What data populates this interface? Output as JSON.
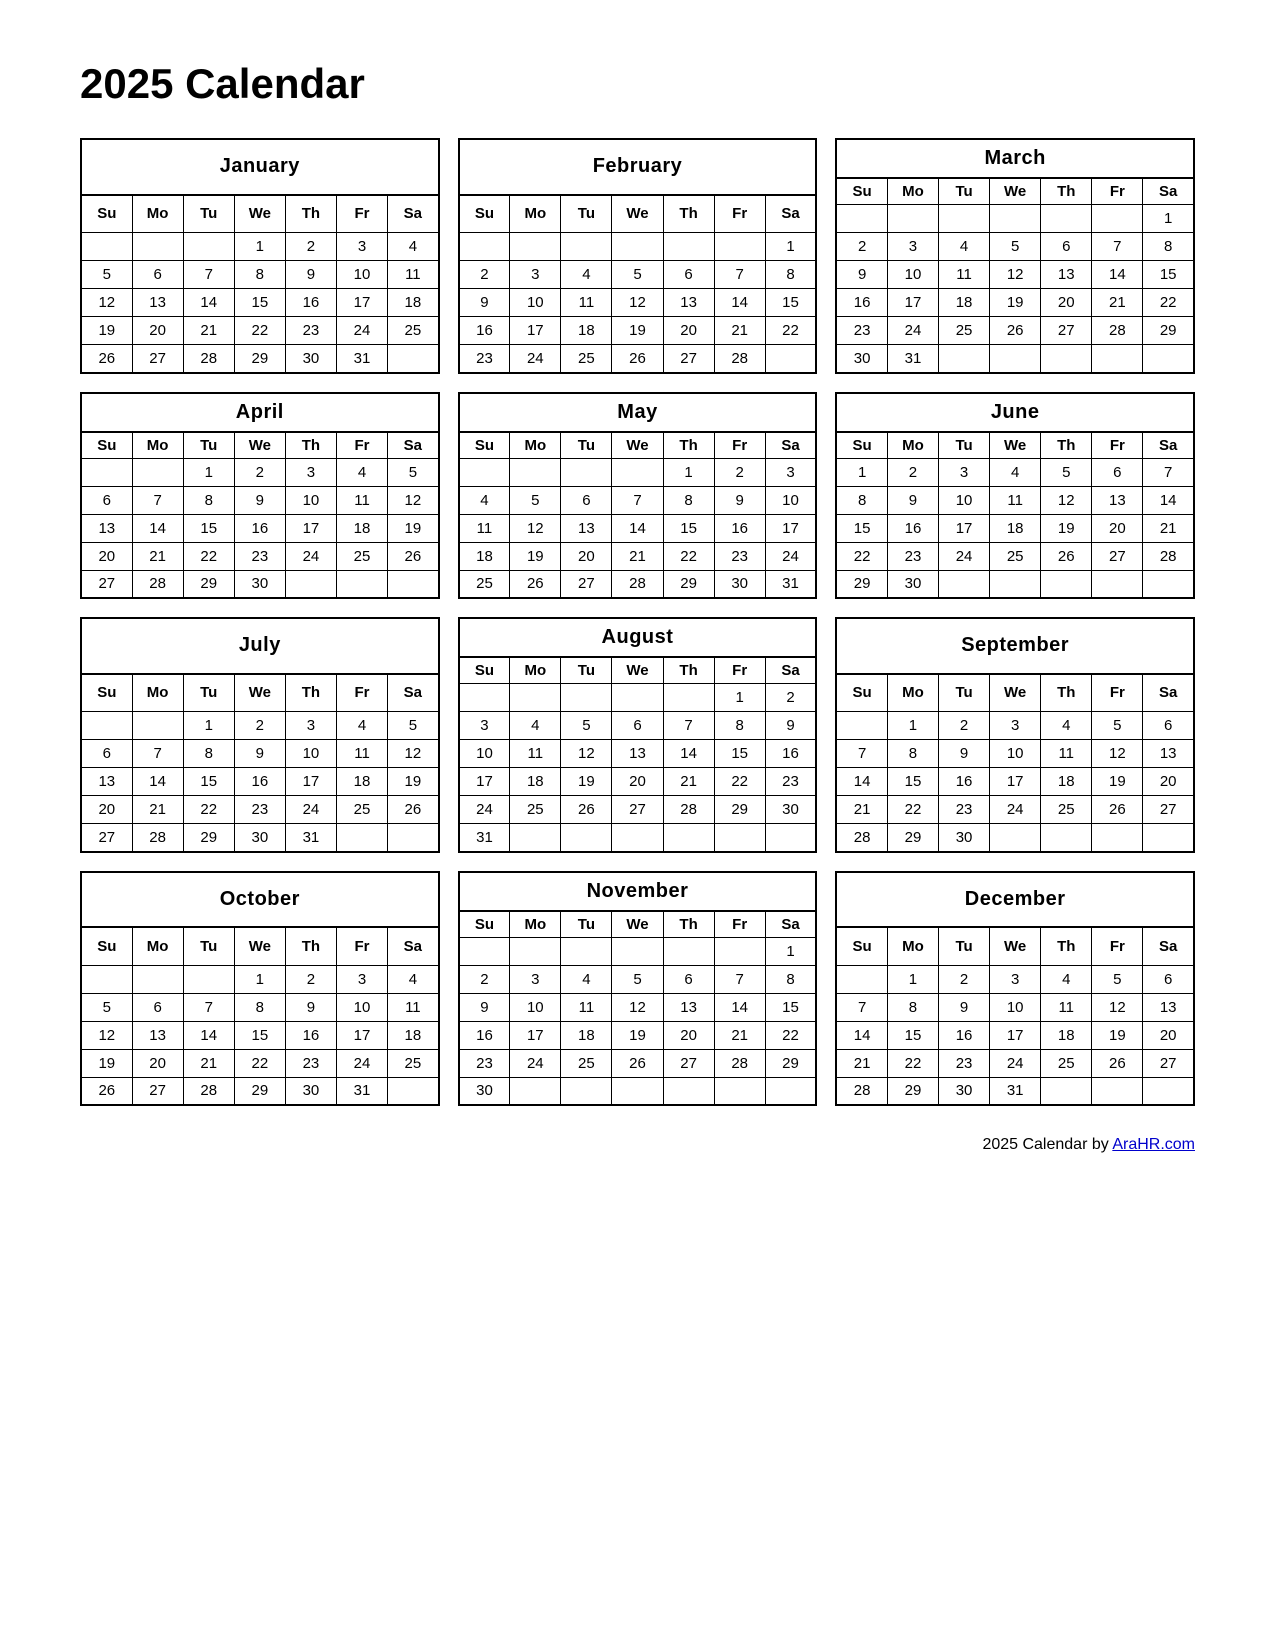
{
  "title": "2025 Calendar",
  "footer": {
    "text": "2025  Calendar by ",
    "link_text": "AraHR.com",
    "link_url": "#"
  },
  "months": [
    {
      "name": "January",
      "days_header": [
        "Su",
        "Mo",
        "Tu",
        "We",
        "Th",
        "Fr",
        "Sa"
      ],
      "weeks": [
        [
          "",
          "",
          "",
          "1",
          "2",
          "3",
          "4"
        ],
        [
          "5",
          "6",
          "7",
          "8",
          "9",
          "10",
          "11"
        ],
        [
          "12",
          "13",
          "14",
          "15",
          "16",
          "17",
          "18"
        ],
        [
          "19",
          "20",
          "21",
          "22",
          "23",
          "24",
          "25"
        ],
        [
          "26",
          "27",
          "28",
          "29",
          "30",
          "31",
          ""
        ]
      ]
    },
    {
      "name": "February",
      "days_header": [
        "Su",
        "Mo",
        "Tu",
        "We",
        "Th",
        "Fr",
        "Sa"
      ],
      "weeks": [
        [
          "",
          "",
          "",
          "",
          "",
          "",
          "1"
        ],
        [
          "2",
          "3",
          "4",
          "5",
          "6",
          "7",
          "8"
        ],
        [
          "9",
          "10",
          "11",
          "12",
          "13",
          "14",
          "15"
        ],
        [
          "16",
          "17",
          "18",
          "19",
          "20",
          "21",
          "22"
        ],
        [
          "23",
          "24",
          "25",
          "26",
          "27",
          "28",
          ""
        ]
      ]
    },
    {
      "name": "March",
      "days_header": [
        "Su",
        "Mo",
        "Tu",
        "We",
        "Th",
        "Fr",
        "Sa"
      ],
      "weeks": [
        [
          "",
          "",
          "",
          "",
          "",
          "",
          "1"
        ],
        [
          "2",
          "3",
          "4",
          "5",
          "6",
          "7",
          "8"
        ],
        [
          "9",
          "10",
          "11",
          "12",
          "13",
          "14",
          "15"
        ],
        [
          "16",
          "17",
          "18",
          "19",
          "20",
          "21",
          "22"
        ],
        [
          "23",
          "24",
          "25",
          "26",
          "27",
          "28",
          "29"
        ],
        [
          "30",
          "31",
          "",
          "",
          "",
          "",
          ""
        ]
      ]
    },
    {
      "name": "April",
      "days_header": [
        "Su",
        "Mo",
        "Tu",
        "We",
        "Th",
        "Fr",
        "Sa"
      ],
      "weeks": [
        [
          "",
          "",
          "1",
          "2",
          "3",
          "4",
          "5"
        ],
        [
          "6",
          "7",
          "8",
          "9",
          "10",
          "11",
          "12"
        ],
        [
          "13",
          "14",
          "15",
          "16",
          "17",
          "18",
          "19"
        ],
        [
          "20",
          "21",
          "22",
          "23",
          "24",
          "25",
          "26"
        ],
        [
          "27",
          "28",
          "29",
          "30",
          "",
          "",
          ""
        ]
      ]
    },
    {
      "name": "May",
      "days_header": [
        "Su",
        "Mo",
        "Tu",
        "We",
        "Th",
        "Fr",
        "Sa"
      ],
      "weeks": [
        [
          "",
          "",
          "",
          "",
          "1",
          "2",
          "3"
        ],
        [
          "4",
          "5",
          "6",
          "7",
          "8",
          "9",
          "10"
        ],
        [
          "11",
          "12",
          "13",
          "14",
          "15",
          "16",
          "17"
        ],
        [
          "18",
          "19",
          "20",
          "21",
          "22",
          "23",
          "24"
        ],
        [
          "25",
          "26",
          "27",
          "28",
          "29",
          "30",
          "31"
        ]
      ]
    },
    {
      "name": "June",
      "days_header": [
        "Su",
        "Mo",
        "Tu",
        "We",
        "Th",
        "Fr",
        "Sa"
      ],
      "weeks": [
        [
          "1",
          "2",
          "3",
          "4",
          "5",
          "6",
          "7"
        ],
        [
          "8",
          "9",
          "10",
          "11",
          "12",
          "13",
          "14"
        ],
        [
          "15",
          "16",
          "17",
          "18",
          "19",
          "20",
          "21"
        ],
        [
          "22",
          "23",
          "24",
          "25",
          "26",
          "27",
          "28"
        ],
        [
          "29",
          "30",
          "",
          "",
          "",
          "",
          ""
        ]
      ]
    },
    {
      "name": "July",
      "days_header": [
        "Su",
        "Mo",
        "Tu",
        "We",
        "Th",
        "Fr",
        "Sa"
      ],
      "weeks": [
        [
          "",
          "",
          "1",
          "2",
          "3",
          "4",
          "5"
        ],
        [
          "6",
          "7",
          "8",
          "9",
          "10",
          "11",
          "12"
        ],
        [
          "13",
          "14",
          "15",
          "16",
          "17",
          "18",
          "19"
        ],
        [
          "20",
          "21",
          "22",
          "23",
          "24",
          "25",
          "26"
        ],
        [
          "27",
          "28",
          "29",
          "30",
          "31",
          "",
          ""
        ]
      ]
    },
    {
      "name": "August",
      "days_header": [
        "Su",
        "Mo",
        "Tu",
        "We",
        "Th",
        "Fr",
        "Sa"
      ],
      "weeks": [
        [
          "",
          "",
          "",
          "",
          "",
          "1",
          "2"
        ],
        [
          "3",
          "4",
          "5",
          "6",
          "7",
          "8",
          "9"
        ],
        [
          "10",
          "11",
          "12",
          "13",
          "14",
          "15",
          "16"
        ],
        [
          "17",
          "18",
          "19",
          "20",
          "21",
          "22",
          "23"
        ],
        [
          "24",
          "25",
          "26",
          "27",
          "28",
          "29",
          "30"
        ],
        [
          "31",
          "",
          "",
          "",
          "",
          "",
          ""
        ]
      ]
    },
    {
      "name": "September",
      "days_header": [
        "Su",
        "Mo",
        "Tu",
        "We",
        "Th",
        "Fr",
        "Sa"
      ],
      "weeks": [
        [
          "",
          "1",
          "2",
          "3",
          "4",
          "5",
          "6"
        ],
        [
          "7",
          "8",
          "9",
          "10",
          "11",
          "12",
          "13"
        ],
        [
          "14",
          "15",
          "16",
          "17",
          "18",
          "19",
          "20"
        ],
        [
          "21",
          "22",
          "23",
          "24",
          "25",
          "26",
          "27"
        ],
        [
          "28",
          "29",
          "30",
          "",
          "",
          "",
          ""
        ]
      ]
    },
    {
      "name": "October",
      "days_header": [
        "Su",
        "Mo",
        "Tu",
        "We",
        "Th",
        "Fr",
        "Sa"
      ],
      "weeks": [
        [
          "",
          "",
          "",
          "1",
          "2",
          "3",
          "4"
        ],
        [
          "5",
          "6",
          "7",
          "8",
          "9",
          "10",
          "11"
        ],
        [
          "12",
          "13",
          "14",
          "15",
          "16",
          "17",
          "18"
        ],
        [
          "19",
          "20",
          "21",
          "22",
          "23",
          "24",
          "25"
        ],
        [
          "26",
          "27",
          "28",
          "29",
          "30",
          "31",
          ""
        ]
      ]
    },
    {
      "name": "November",
      "days_header": [
        "Su",
        "Mo",
        "Tu",
        "We",
        "Th",
        "Fr",
        "Sa"
      ],
      "weeks": [
        [
          "",
          "",
          "",
          "",
          "",
          "",
          "1"
        ],
        [
          "2",
          "3",
          "4",
          "5",
          "6",
          "7",
          "8"
        ],
        [
          "9",
          "10",
          "11",
          "12",
          "13",
          "14",
          "15"
        ],
        [
          "16",
          "17",
          "18",
          "19",
          "20",
          "21",
          "22"
        ],
        [
          "23",
          "24",
          "25",
          "26",
          "27",
          "28",
          "29"
        ],
        [
          "30",
          "",
          "",
          "",
          "",
          "",
          ""
        ]
      ]
    },
    {
      "name": "December",
      "days_header": [
        "Su",
        "Mo",
        "Tu",
        "We",
        "Th",
        "Fr",
        "Sa"
      ],
      "weeks": [
        [
          "",
          "1",
          "2",
          "3",
          "4",
          "5",
          "6"
        ],
        [
          "7",
          "8",
          "9",
          "10",
          "11",
          "12",
          "13"
        ],
        [
          "14",
          "15",
          "16",
          "17",
          "18",
          "19",
          "20"
        ],
        [
          "21",
          "22",
          "23",
          "24",
          "25",
          "26",
          "27"
        ],
        [
          "28",
          "29",
          "30",
          "31",
          "",
          "",
          ""
        ]
      ]
    }
  ]
}
